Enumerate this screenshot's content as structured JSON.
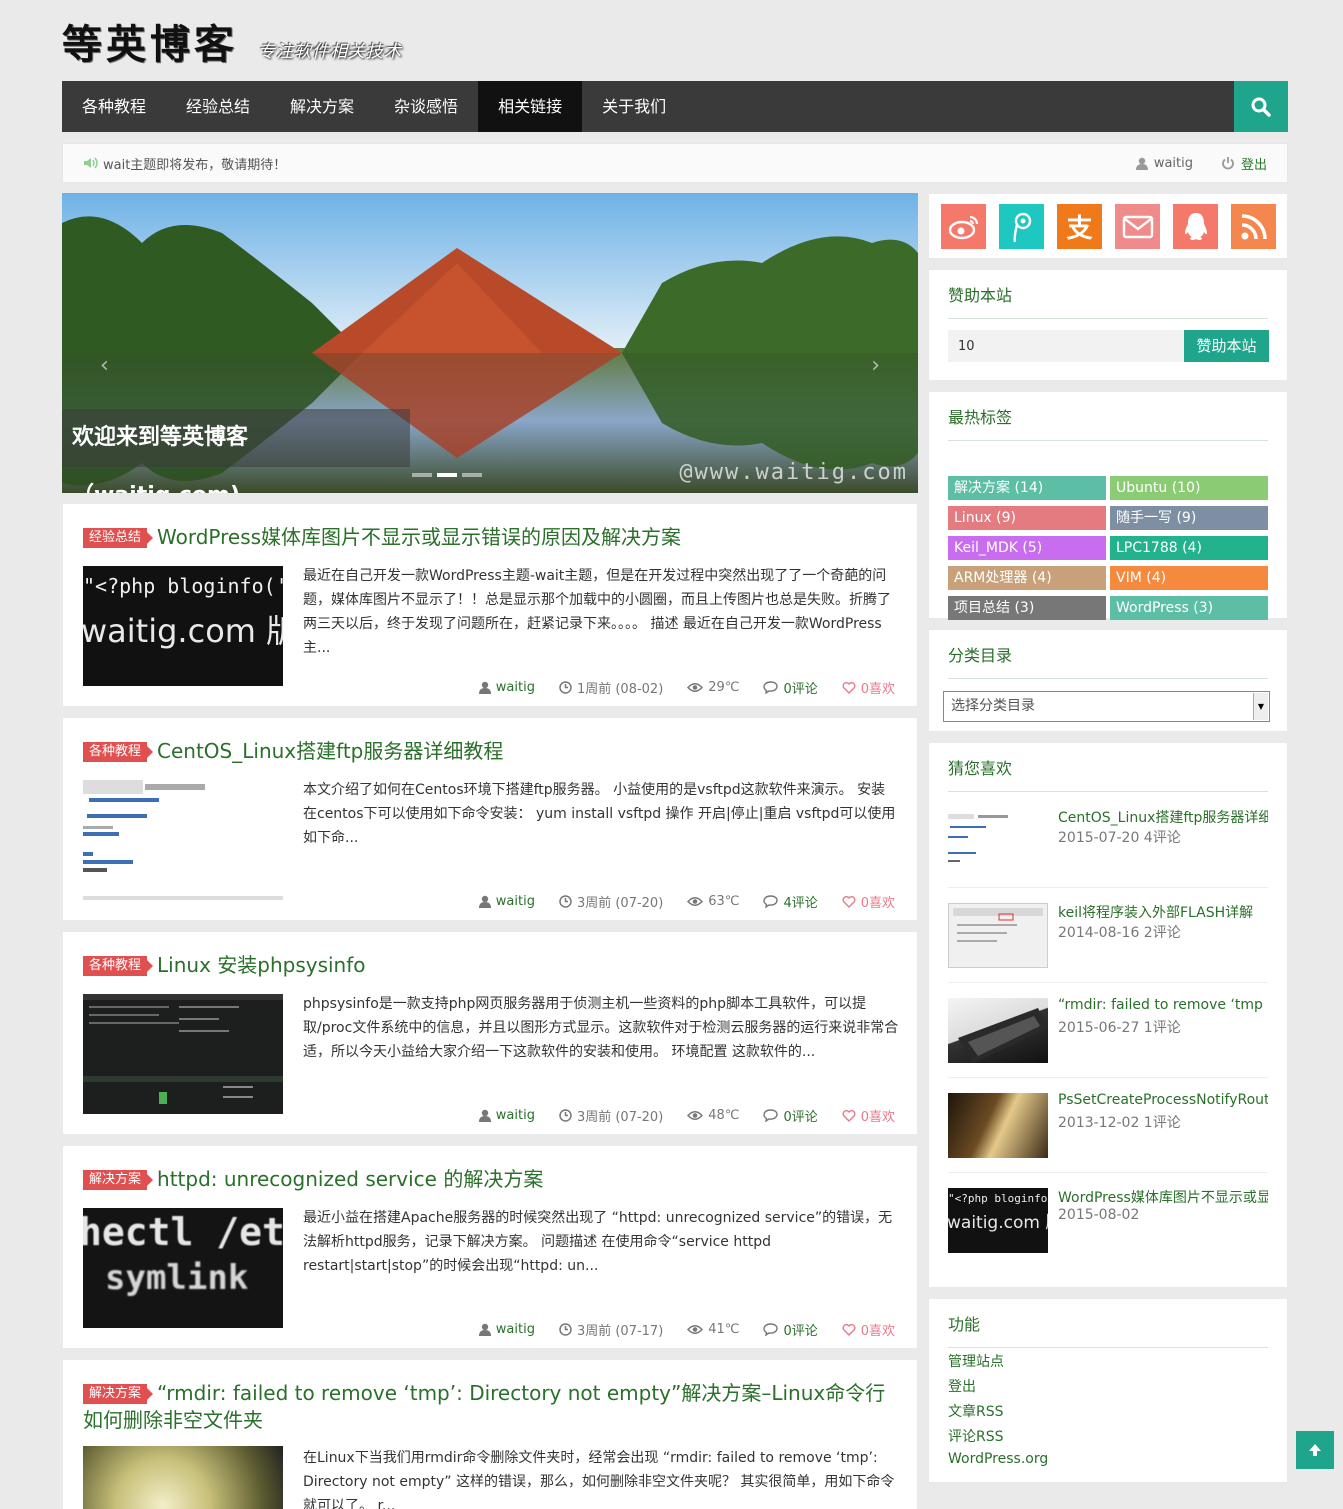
{
  "site": {
    "title": "等英博客",
    "tagline": "专注软件相关技术"
  },
  "nav": {
    "items": [
      "各种教程",
      "经验总结",
      "解决方案",
      "杂谈感悟",
      "相关链接",
      "关于我们"
    ],
    "active_index": 4,
    "search_icon": "search-icon"
  },
  "notice": {
    "text": "wait主题即将发布，敬请期待！",
    "username": "waitig",
    "logout": "登出"
  },
  "slider": {
    "caption": "欢迎来到等英博客（waitig.com)",
    "watermark": "@www.waitig.com",
    "active_dot": 1
  },
  "posts": [
    {
      "category": "经验总结",
      "title": "WordPress媒体库图片不显示或显示错误的原因及解决方案",
      "excerpt": "最近在自己开发一款WordPress主题-wait主题，但是在开发过程中突然出现了了一个奇葩的问题，媒体库图片不显示了！！总是显示那个加载中的小圆圈，而且上传图片也总是失败。折腾了两三天以后，终于发现了问题所在，赶紧记录下来。。。。 描述 最近在自己开发一款WordPress主...",
      "thumb_text_1": "\"<?php bloginfo('t",
      "thumb_text_2": "waitig.com 版",
      "author": "waitig",
      "time": "1周前 (08-02)",
      "temp": "29℃",
      "comments": "0评论",
      "likes": "0喜欢"
    },
    {
      "category": "各种教程",
      "title": "CentOS_Linux搭建ftp服务器详细教程",
      "excerpt": "本文介绍了如何在Centos环境下搭建ftp服务器。 小益使用的是vsftpd这款软件来演示。 安装 在centos下可以使用如下命令安装： yum install vsftpd 操作 开启|停止|重启 vsftpd可以使用如下命...",
      "author": "waitig",
      "time": "3周前 (07-20)",
      "temp": "63℃",
      "comments": "4评论",
      "likes": "0喜欢"
    },
    {
      "category": "各种教程",
      "title": "Linux 安装phpsysinfo",
      "excerpt": "phpsysinfo是一款支持php网页服务器用于侦测主机一些资料的php脚本工具软件，可以提取/proc文件系统中的信息，并且以图形方式显示。这款软件对于检测云服务器的运行来说非常合适，所以今天小益给大家介绍一下这款软件的安装和使用。 环境配置 这款软件的...",
      "author": "waitig",
      "time": "3周前 (07-20)",
      "temp": "48℃",
      "comments": "0评论",
      "likes": "0喜欢"
    },
    {
      "category": "解决方案",
      "title": "httpd: unrecognized service 的解决方案",
      "excerpt": "最近小益在搭建Apache服务器的时候突然出现了 “httpd: unrecognized service”的错误，无法解析httpd服务，记录下解决方案。 问题描述 在使用命令“service httpd restart|start|stop”的时候会出现“httpd: un...",
      "thumb_text_1": "hectl /et",
      "thumb_text_2": "symlink",
      "author": "waitig",
      "time": "3周前 (07-17)",
      "temp": "41℃",
      "comments": "0评论",
      "likes": "0喜欢"
    },
    {
      "category": "解决方案",
      "title": "“rmdir: failed to remove ‘tmp’: Directory not empty”解决方案–Linux命令行如何删除非空文件夹",
      "excerpt": "在Linux下当我们用rmdir命令删除文件夹时，经常会出现 “rmdir: failed to remove ‘tmp’: Directory not empty” 这样的错误，那么，如何删除非空文件夹呢？ 其实很简单，用如下命令就可以了。 r..."
    }
  ],
  "sidebar": {
    "social_icons": [
      "weibo-icon",
      "tencent-weibo-icon",
      "alipay-icon",
      "mail-icon",
      "qq-icon",
      "rss-icon"
    ],
    "social_colors": [
      "#f5796b",
      "#1fc7c1",
      "#f07a1a",
      "#f08b8b",
      "#f5796b",
      "#f5864d"
    ],
    "alipay_glyph": "支",
    "donate": {
      "title": "赞助本站",
      "value": "10",
      "button": "赞助本站"
    },
    "tags": {
      "title": "最热标签",
      "items": [
        {
          "label": "解决方案 (14)",
          "color": "#5cbfa5"
        },
        {
          "label": "Ubuntu (10)",
          "color": "#8bcb74"
        },
        {
          "label": "Linux (9)",
          "color": "#e47b80"
        },
        {
          "label": "随手一写 (9)",
          "color": "#7f8fa3"
        },
        {
          "label": "Keil_MDK (5)",
          "color": "#c86cf0"
        },
        {
          "label": "LPC1788 (4)",
          "color": "#22b38d"
        },
        {
          "label": "ARM处理器 (4)",
          "color": "#c8a07a"
        },
        {
          "label": "VIM (4)",
          "color": "#f58a3e"
        },
        {
          "label": "项目总结 (3)",
          "color": "#777777"
        },
        {
          "label": "WordPress (3)",
          "color": "#5cbfa5"
        }
      ]
    },
    "categories": {
      "title": "分类目录",
      "selected": "选择分类目录"
    },
    "related": {
      "title": "猜您喜欢",
      "items": [
        {
          "title": "CentOS_Linux搭建ftp服务器详细",
          "meta": "2015-07-20   4评论"
        },
        {
          "title": "keil将程序装入外部FLASH详解",
          "meta": "2014-08-16   2评论"
        },
        {
          "title": "“rmdir: failed to remove ‘tmp",
          "meta": "2015-06-27   1评论"
        },
        {
          "title": "PsSetCreateProcessNotifyRouti",
          "meta": "2013-12-02   1评论"
        },
        {
          "title": "WordPress媒体库图片不显示或显",
          "meta": "2015-08-02"
        }
      ]
    },
    "functions": {
      "title": "功能",
      "links": [
        "管理站点",
        "登出",
        "文章RSS",
        "评论RSS",
        "WordPress.org"
      ]
    }
  },
  "back_to_top_icon": "arrow-up-icon"
}
